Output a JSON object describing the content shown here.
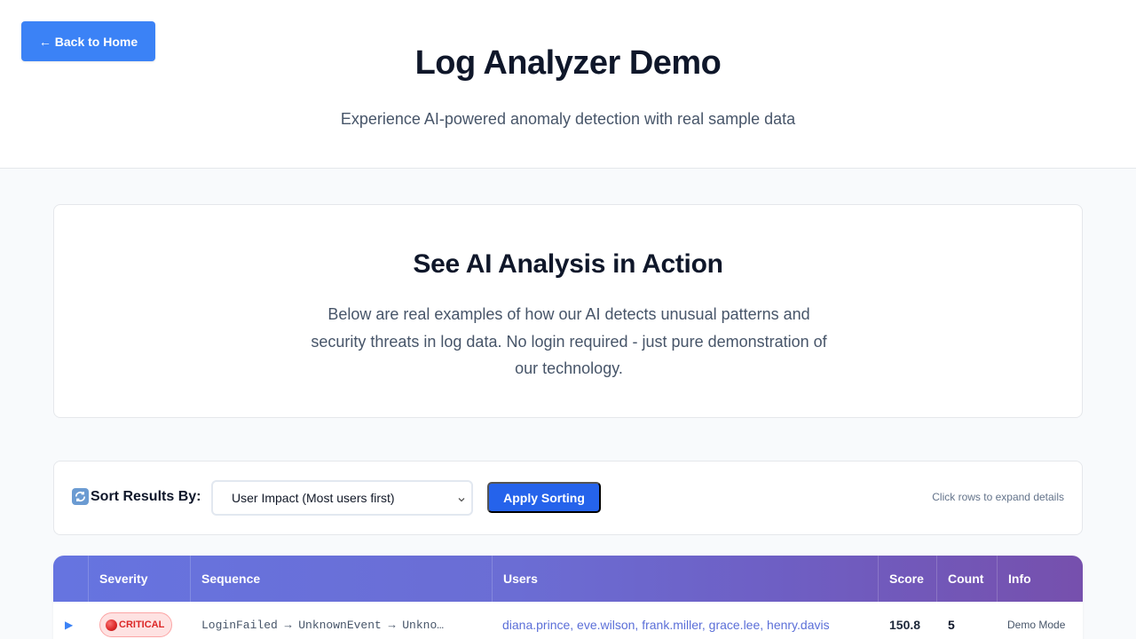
{
  "header": {
    "back_label": "← Back to Home",
    "title": "Log Analyzer Demo",
    "subtitle": "Experience AI-powered anomaly detection with real sample data"
  },
  "intro": {
    "title": "See AI Analysis in Action",
    "text": "Below are real examples of how our AI detects unusual patterns and security threats in log data. No login required - just pure demonstration of our technology."
  },
  "sort": {
    "icon": "refresh-icon",
    "label": "Sort Results By:",
    "selected_option": "User Impact (Most users first)",
    "apply_label": "Apply Sorting",
    "hint": "Click rows to expand details"
  },
  "table": {
    "columns": [
      "",
      "Severity",
      "Sequence",
      "Users",
      "Score",
      "Count",
      "Info"
    ],
    "rows": [
      {
        "expand_icon": "▶",
        "severity": "CRITICAL",
        "sequence": "LoginFailed → UnknownEvent → Unkno…",
        "users": "diana.prince, eve.wilson, frank.miller, grace.lee, henry.davis",
        "score": "150.8",
        "count": "5",
        "info": "Demo Mode"
      }
    ]
  },
  "colors": {
    "primary": "#3b82f6",
    "apply_button": "#2563eb",
    "critical": "#dc2626",
    "header_gradient_start": "#6674e0",
    "header_gradient_end": "#7650ad"
  }
}
